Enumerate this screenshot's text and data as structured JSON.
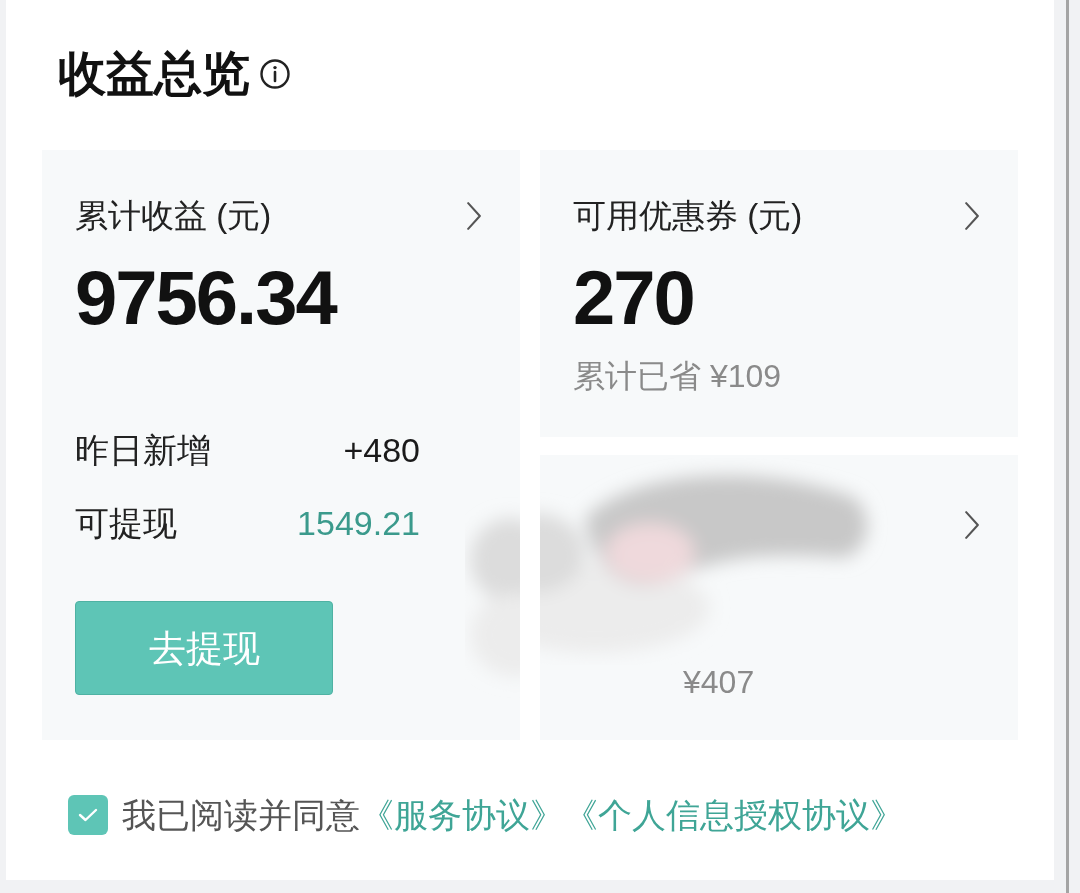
{
  "title": "收益总览",
  "cards": [
    {
      "kind": "earnings",
      "label": "累计收益 (元)",
      "value": "9756.34",
      "rows": [
        {
          "label": "昨日新增",
          "value": "+480",
          "color": "#1a1a1a"
        },
        {
          "label": "可提现",
          "value": "1549.21",
          "color": "#3b9a8c"
        }
      ],
      "button": "去提现"
    },
    {
      "kind": "coupon",
      "label": "可用优惠券 (元)",
      "value": "270",
      "note": "累计已省 ¥109"
    },
    {
      "kind": "redacted",
      "note": "¥407"
    }
  ],
  "agreement": {
    "checked": true,
    "text": "我已阅读并同意",
    "links": [
      "《服务协议》",
      "《个人信息授权协议》"
    ]
  }
}
